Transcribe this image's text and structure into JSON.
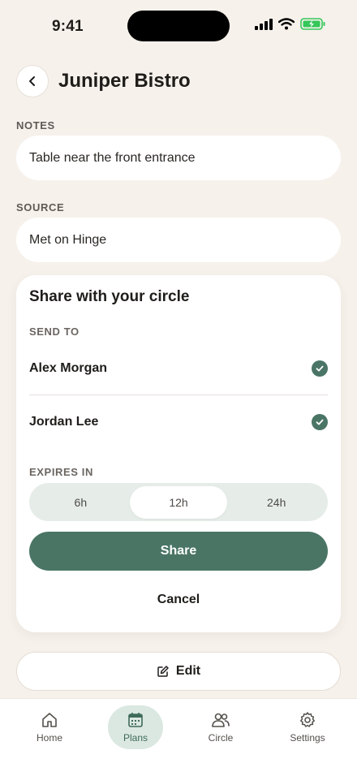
{
  "status_bar": {
    "time": "9:41"
  },
  "header": {
    "title": "Juniper Bistro"
  },
  "notes": {
    "label": "NOTES",
    "value": "Table near the front entrance"
  },
  "source": {
    "label": "SOURCE",
    "value": "Met on Hinge"
  },
  "share_card": {
    "title": "Share with your circle",
    "send_to_label": "SEND TO",
    "recipients": [
      {
        "name": "Alex Morgan",
        "selected": true
      },
      {
        "name": "Jordan Lee",
        "selected": true
      }
    ],
    "expires_label": "EXPIRES IN",
    "expiry_options": [
      "6h",
      "12h",
      "24h"
    ],
    "selected_expiry": "12h",
    "share_label": "Share",
    "cancel_label": "Cancel"
  },
  "edit_label": "Edit",
  "tabs": [
    {
      "label": "Home",
      "icon": "home-icon"
    },
    {
      "label": "Plans",
      "icon": "calendar-icon",
      "active": true
    },
    {
      "label": "Circle",
      "icon": "people-icon"
    },
    {
      "label": "Settings",
      "icon": "gear-icon"
    }
  ],
  "colors": {
    "background": "#f6f1eb",
    "accent": "#4a7565",
    "active_tab_bg": "#dbe8e1",
    "battery": "#34c759"
  }
}
